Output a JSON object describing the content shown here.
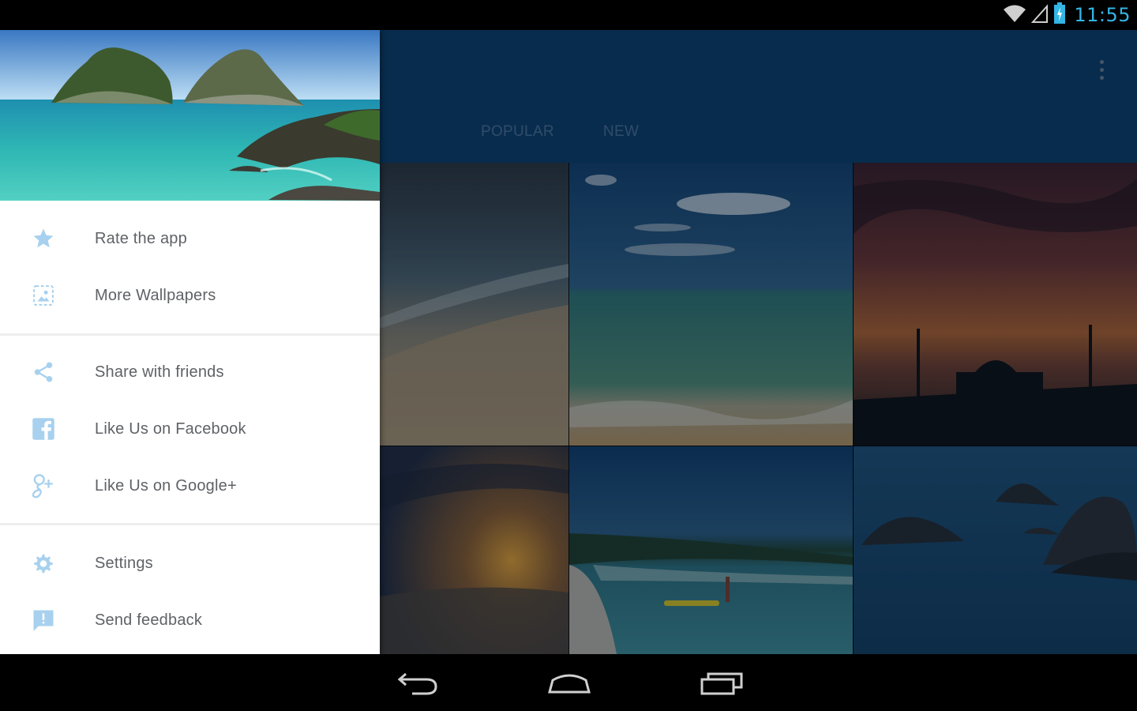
{
  "status_bar": {
    "time": "11:55",
    "icons": [
      "wifi-icon",
      "signal-icon",
      "battery-charging-icon"
    ],
    "time_color": "#33b5e5"
  },
  "toolbar": {
    "background": "#0b3a64",
    "overflow_icon": "more-vertical-icon",
    "tabs": [
      {
        "label": "POPULAR"
      },
      {
        "label": "NEW"
      }
    ]
  },
  "drawer": {
    "header_image": "island-lagoon-photo",
    "sections": [
      {
        "items": [
          {
            "label": "Rate the app",
            "icon": "star-icon"
          },
          {
            "label": "More Wallpapers",
            "icon": "image-icon"
          }
        ]
      },
      {
        "items": [
          {
            "label": "Share with friends",
            "icon": "share-icon"
          },
          {
            "label": "Like Us on Facebook",
            "icon": "facebook-icon"
          },
          {
            "label": "Like Us on Google+",
            "icon": "google-plus-icon"
          }
        ]
      },
      {
        "items": [
          {
            "label": "Settings",
            "icon": "gear-icon"
          },
          {
            "label": "Send feedback",
            "icon": "feedback-icon"
          }
        ]
      }
    ],
    "icon_color": "#a7d1ee",
    "label_color": "#5f6266"
  },
  "wallpapers": [
    {
      "name": "beach-shore"
    },
    {
      "name": "ocean-clouds"
    },
    {
      "name": "pier-sunset"
    },
    {
      "name": "sea-sunset"
    },
    {
      "name": "tropical-beach-kayak"
    },
    {
      "name": "rocky-coast"
    }
  ],
  "nav_bar": {
    "buttons": [
      "back-icon",
      "home-icon",
      "recent-apps-icon"
    ]
  }
}
